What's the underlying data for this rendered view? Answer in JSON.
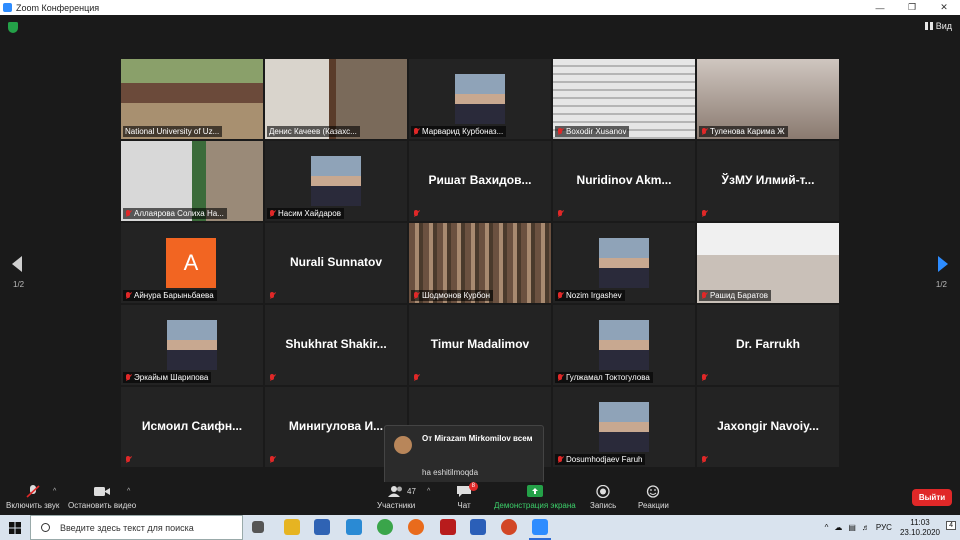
{
  "window": {
    "title": "Zoom Конференция",
    "view_label": "Вид"
  },
  "pager": {
    "left": "1/2",
    "right": "1/2"
  },
  "participants": [
    {
      "name": "National University of Uz...",
      "kind": "video",
      "scene": "conference",
      "active": true
    },
    {
      "name": "Денис Качеев (Казахс...",
      "kind": "video",
      "scene": "library"
    },
    {
      "name": "Марварид Курбоназ...",
      "kind": "photo",
      "muted": true
    },
    {
      "name": "Boxodir Xusanov",
      "kind": "video",
      "scene": "blinds",
      "muted": true
    },
    {
      "name": "Туленова Карима Ж",
      "kind": "video",
      "scene": "woman",
      "muted": true
    },
    {
      "name": "Аллаярова Солиха На...",
      "kind": "video",
      "scene": "office",
      "muted": true
    },
    {
      "name": "Насим Хайдаров",
      "kind": "photo",
      "muted": true
    },
    {
      "name": "Ришат Вахидов...",
      "kind": "name",
      "muted": true
    },
    {
      "name": "Nuridinov Akm...",
      "kind": "name",
      "muted": true
    },
    {
      "name": "ЎзМУ Илмий-т...",
      "kind": "name",
      "muted": true
    },
    {
      "name": "Айнура Барыньбаева",
      "kind": "letter",
      "letter": "A",
      "muted": true
    },
    {
      "name": "Nurali Sunnatov",
      "kind": "name",
      "muted": true
    },
    {
      "name": "Шодмонов Курбон",
      "kind": "video",
      "scene": "books",
      "muted": true
    },
    {
      "name": "Nozim Irgashev",
      "kind": "photo",
      "muted": true
    },
    {
      "name": "Рашид Баратов",
      "kind": "video",
      "scene": "man",
      "muted": true
    },
    {
      "name": "Эркайым Шарипова",
      "kind": "photo",
      "muted": true
    },
    {
      "name": "Shukhrat Shakir...",
      "kind": "name",
      "muted": true
    },
    {
      "name": "Timur Madalimov",
      "kind": "name",
      "muted": true
    },
    {
      "name": "Гулжамал Токтогулова",
      "kind": "photo",
      "muted": true
    },
    {
      "name": "Dr. Farrukh",
      "kind": "name",
      "muted": true
    },
    {
      "name": "Исмоил Саифн...",
      "kind": "name",
      "muted": true
    },
    {
      "name": "Минигулова И...",
      "kind": "name",
      "muted": true
    },
    {
      "name": "",
      "kind": "name",
      "muted": true
    },
    {
      "name": "Dosumhodjaev Faruh",
      "kind": "photo",
      "muted": true
    },
    {
      "name": "Jaxongir Navoiy...",
      "kind": "name",
      "muted": true
    }
  ],
  "chat_popup": {
    "from": "От Mirazam Mirkomilov всем",
    "message": "ha eshitilmoqda"
  },
  "toolbar": {
    "unmute": "Включить звук",
    "stop_video": "Остановить видео",
    "participants": "Участники",
    "participants_count": "47",
    "chat": "Чат",
    "chat_badge": "8",
    "share": "Демонстрация экрана",
    "record": "Запись",
    "reactions": "Реакции",
    "leave": "Выйти"
  },
  "taskbar": {
    "search_placeholder": "Введите здесь текст для поиска",
    "language": "РУС",
    "time": "11:03",
    "date": "23.10.2020",
    "notifications": "4"
  },
  "colors": {
    "accent": "#2d8cff",
    "active_speaker": "#c9e02f",
    "leave": "#e02828",
    "share": "#24a148"
  }
}
